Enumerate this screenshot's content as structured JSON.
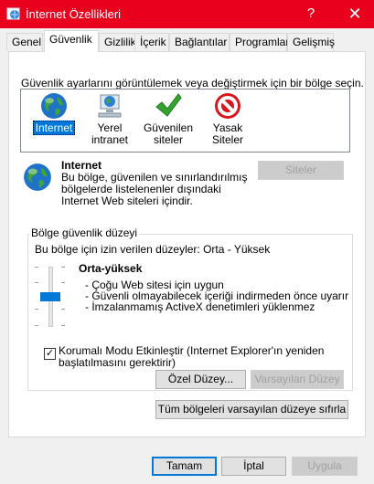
{
  "window": {
    "title": "İnternet Özellikleri",
    "help_label": "?",
    "close_label": "✕"
  },
  "tabs": [
    {
      "label": "Genel"
    },
    {
      "label": "Güvenlik"
    },
    {
      "label": "Gizlilik"
    },
    {
      "label": "İçerik"
    },
    {
      "label": "Bağlantılar"
    },
    {
      "label": "Programlar"
    },
    {
      "label": "Gelişmiş"
    }
  ],
  "security": {
    "instruction": "Güvenlik ayarlarını görüntülemek veya değiştirmek için bir bölge seçin.",
    "zones": [
      {
        "line1": "Internet",
        "line2": "",
        "icon": "globe-icon"
      },
      {
        "line1": "Yerel",
        "line2": "intranet",
        "icon": "intranet-icon"
      },
      {
        "line1": "Güvenilen",
        "line2": "siteler",
        "icon": "check-icon"
      },
      {
        "line1": "Yasak",
        "line2": "Siteler",
        "icon": "restricted-icon"
      }
    ],
    "selected_zone": {
      "name": "Internet",
      "description": "Bu bölge, güvenilen ve sınırlandırılmış bölgelerde listelenenler dışındaki Internet Web siteleri içindir."
    },
    "sites_button": "Siteler",
    "group_title": "Bölge güvenlik düzeyi",
    "allowed_levels": "Bu bölge için izin verilen düzeyler: Orta - Yüksek",
    "level": {
      "name": "Orta-yüksek",
      "bullets": [
        "- Çoğu Web sitesi için uygun",
        "- Güvenli olmayabilecek içeriği indirmeden önce uyarır",
        "- İmzalanmamış ActiveX denetimleri yüklenmez"
      ],
      "slider_position": "2 of 4"
    },
    "protected_mode": {
      "checked": true,
      "label": "Korumalı Modu Etkinleştir (Internet Explorer'ın yeniden başlatılmasını gerektirir)"
    },
    "custom_button": "Özel Düzey...",
    "default_button": "Varsayılan Düzey",
    "reset_all_button": "Tüm bölgeleri varsayılan düzeye sıfırla"
  },
  "footer": {
    "ok": "Tamam",
    "cancel": "İptal",
    "apply": "Uygula"
  }
}
